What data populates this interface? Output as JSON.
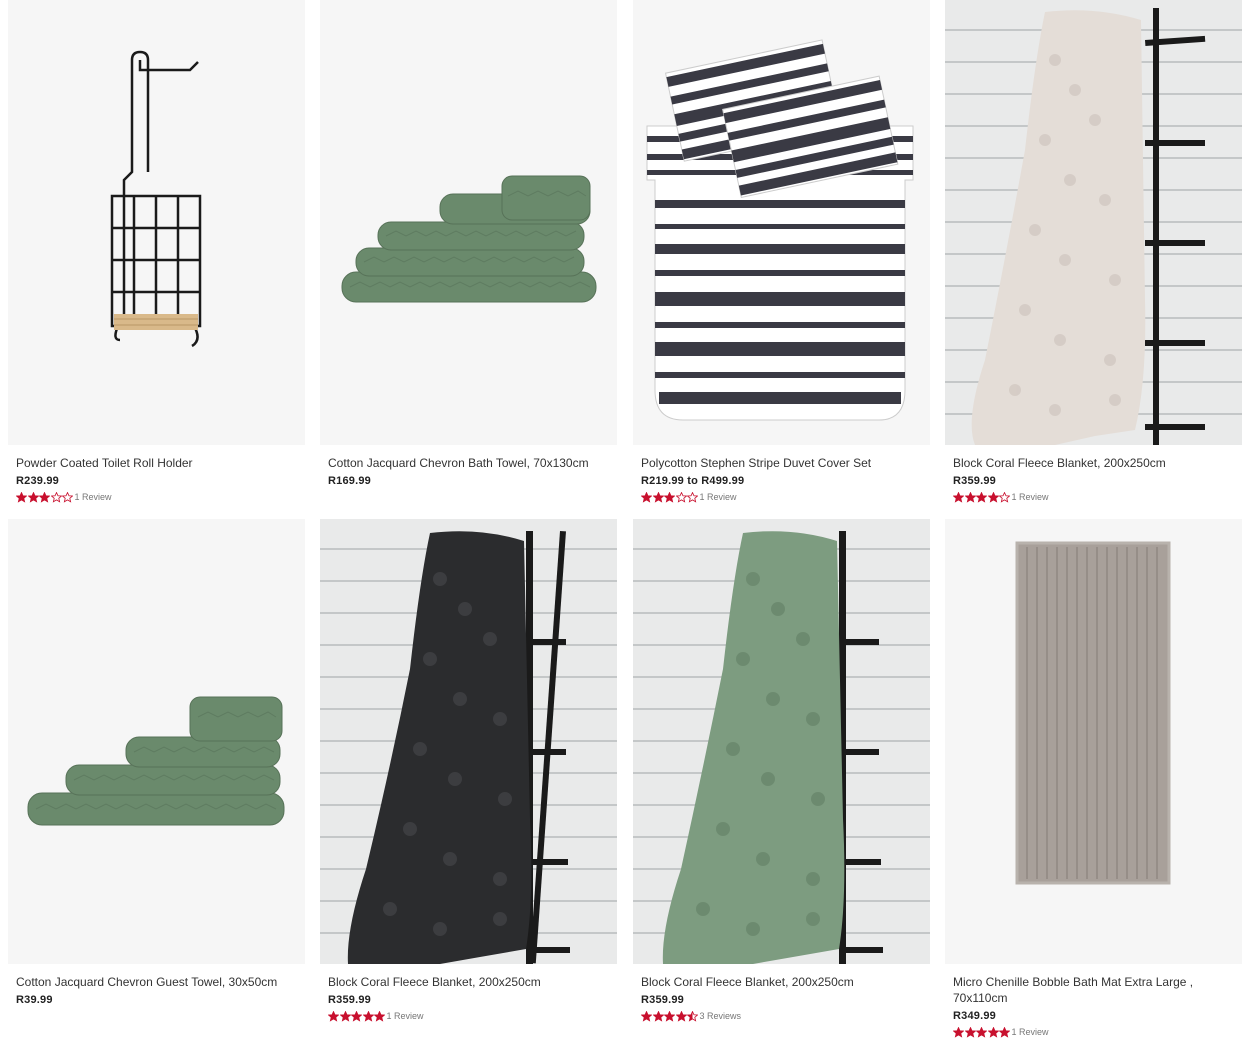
{
  "colors": {
    "star": "#c8102e",
    "price": "#222222",
    "text": "#333333"
  },
  "products": [
    {
      "name": "Powder Coated Toilet Roll Holder",
      "price": "R239.99",
      "rating": 3,
      "reviews": "1 Review",
      "image_icon": "toilet-roll-holder"
    },
    {
      "name": "Cotton Jacquard Chevron Bath Towel, 70x130cm",
      "price": "R169.99",
      "rating": null,
      "reviews": "",
      "image_icon": "green-towel-stack"
    },
    {
      "name": "Polycotton Stephen Stripe Duvet Cover Set",
      "price": "R219.99 to R499.99",
      "rating": 3,
      "reviews": "1 Review",
      "image_icon": "striped-duvet"
    },
    {
      "name": "Block Coral Fleece Blanket, 200x250cm",
      "price": "R359.99",
      "rating": 4,
      "reviews": "1 Review",
      "image_icon": "cream-blanket-on-ladder"
    },
    {
      "name": "Cotton Jacquard Chevron Guest Towel, 30x50cm",
      "price": "R39.99",
      "rating": null,
      "reviews": "",
      "image_icon": "green-towel-stack"
    },
    {
      "name": "Block Coral Fleece Blanket, 200x250cm",
      "price": "R359.99",
      "rating": 5,
      "reviews": "1 Review",
      "image_icon": "black-blanket-on-ladder"
    },
    {
      "name": "Block Coral Fleece Blanket, 200x250cm",
      "price": "R359.99",
      "rating": 4.5,
      "reviews": "3 Reviews",
      "image_icon": "green-blanket-on-ladder"
    },
    {
      "name": "Micro Chenille Bobble Bath Mat Extra Large , 70x110cm",
      "price": "R349.99",
      "rating": 5,
      "reviews": "1 Review",
      "image_icon": "grey-bath-mat"
    }
  ]
}
